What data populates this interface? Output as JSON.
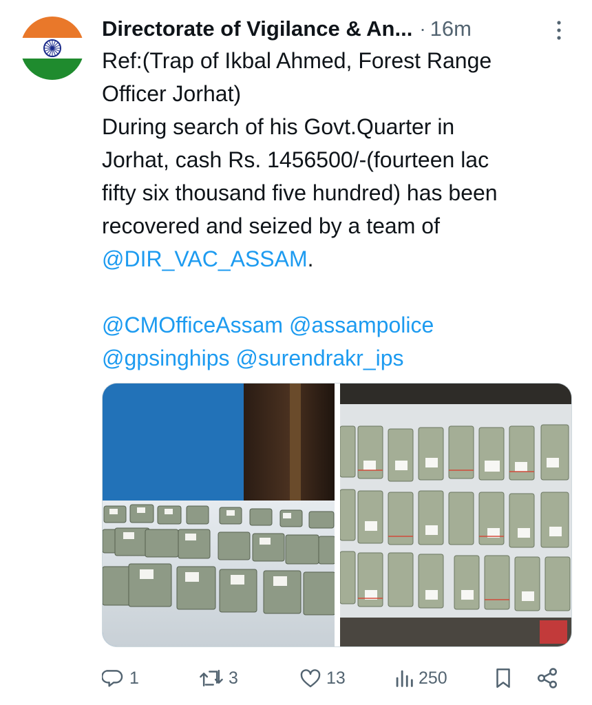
{
  "tweet": {
    "author_name": "Directorate of Vigilance & An...",
    "separator": "·",
    "time": "16m",
    "lines": [
      "Ref:(Trap of Ikbal Ahmed, Forest Range",
      "Officer Jorhat)",
      "During search of his Govt.Quarter in",
      "Jorhat, cash Rs. 1456500/-(fourteen lac",
      "fifty six thousand five hundred) has been",
      "recovered and seized by a team of"
    ],
    "mention_main": "@DIR_VAC_ASSAM",
    "mention_main_suffix": ".",
    "mentions_line1": [
      "@CMOfficeAssam",
      "@assampolice"
    ],
    "mentions_line2": [
      "@gpsinghips",
      "@surendrakr_ips"
    ]
  },
  "actions": {
    "replies": "1",
    "reposts": "3",
    "likes": "13",
    "views": "250"
  },
  "colors": {
    "link": "#1d9bf0",
    "secondary_text": "#536471",
    "flag_saffron": "#e9782a",
    "flag_green": "#1f8b2e",
    "chakra": "#1a2a8a"
  }
}
